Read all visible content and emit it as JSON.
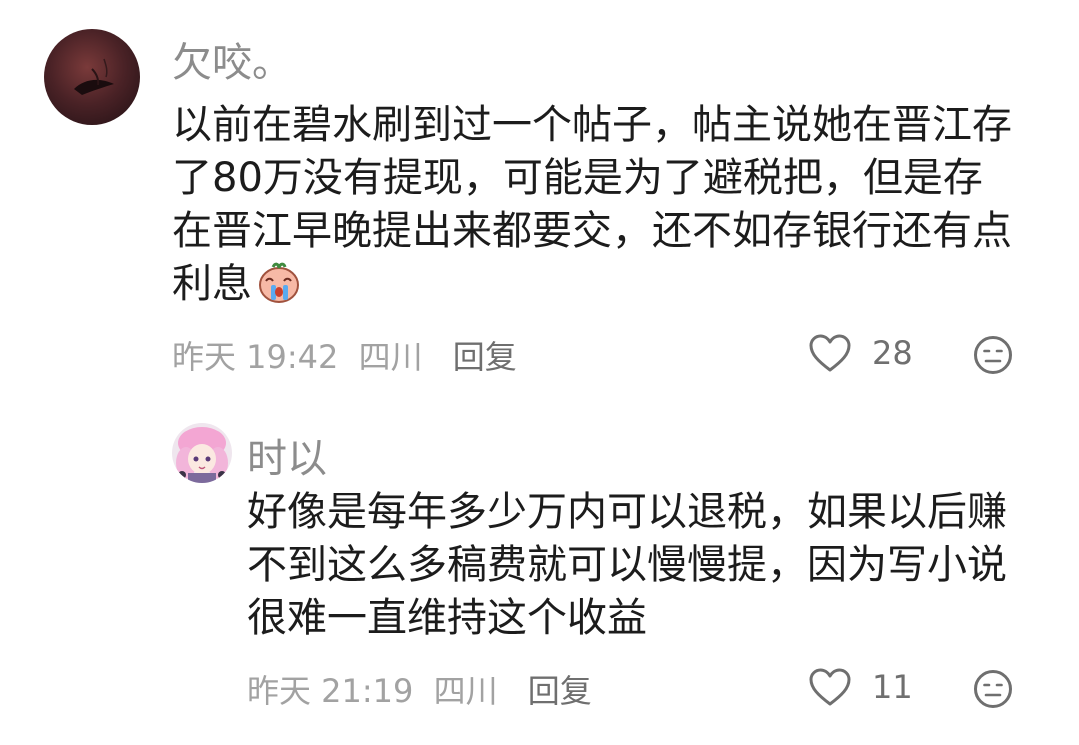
{
  "comments": [
    {
      "username": "欠咬。",
      "text": "以前在碧水刷到过一个帖子，帖主说她在晋江存了80万没有提现，可能是为了避税把，但是存在晋江早晚提出来都要交，还不如存银行还有点利息",
      "emoji": "crying-face-emoji",
      "time": "昨天 19:42",
      "location": "四川",
      "reply_label": "回复",
      "like_count": "28",
      "avatar": "dark-red-photo-avatar"
    },
    {
      "username": "时以",
      "text": "好像是每年多少万内可以退税，如果以后赚不到这么多稿费就可以慢慢提，因为写小说很难一直维持这个收益",
      "time": "昨天 21:19",
      "location": "四川",
      "reply_label": "回复",
      "like_count": "11",
      "avatar": "pink-anime-avatar"
    }
  ],
  "icons": {
    "like": "heart-icon",
    "dislike": "neutral-face-icon"
  },
  "colors": {
    "text": "#1c1c1c",
    "username": "#8c8c8c",
    "meta": "#a2a2a2",
    "action": "#6f6f6f"
  }
}
